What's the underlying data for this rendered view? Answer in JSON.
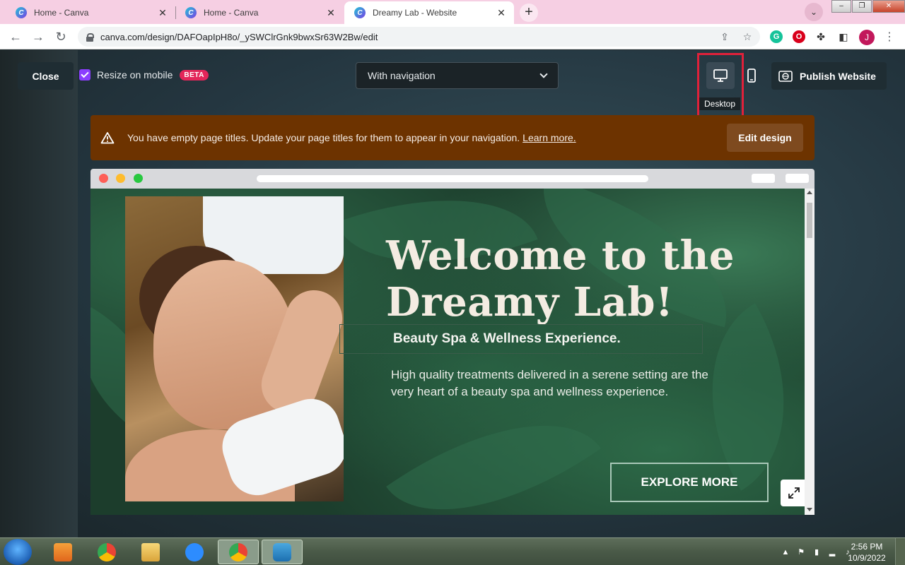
{
  "browser": {
    "tabs": [
      {
        "title": "Home - Canva",
        "active": false
      },
      {
        "title": "Home - Canva",
        "active": false
      },
      {
        "title": "Dreamy Lab - Website",
        "active": true
      }
    ],
    "new_tab_symbol": "+",
    "url": "canva.com/design/DAFOapIpH8o/_ySWClrGnk9bwxSr63W2Bw/edit",
    "profile_initial": "J",
    "favicon_letter": "C",
    "tab_close_symbol": "✕"
  },
  "toolbar": {
    "close_label": "Close",
    "resize_label": "Resize on mobile",
    "beta_label": "BETA",
    "navigation_select": "With navigation",
    "desktop_tooltip": "Desktop",
    "publish_label": "Publish Website"
  },
  "banner": {
    "message": "You have empty page titles. Update your page titles for them to appear in your navigation.",
    "link": "Learn more.",
    "button": "Edit design"
  },
  "site": {
    "title_line1": "Welcome to the",
    "title_line2": "Dreamy Lab!",
    "subtitle": "Beauty Spa & Wellness Experience.",
    "description": "High quality treatments delivered in a serene setting are the very heart of a beauty spa and wellness experience.",
    "cta": "EXPLORE MORE"
  },
  "taskbar": {
    "apps": [
      "media-player",
      "chrome",
      "file-explorer",
      "zoom",
      "chrome-profile",
      "app-hexagon"
    ],
    "time": "2:56 PM",
    "date": "10/9/2022"
  },
  "colors": {
    "tabbar": "#f6cfe3",
    "canva_purple": "#8b3dff",
    "beta_red": "#e3265a",
    "banner_brown": "#6d3300",
    "highlight_red": "#e0213a"
  }
}
